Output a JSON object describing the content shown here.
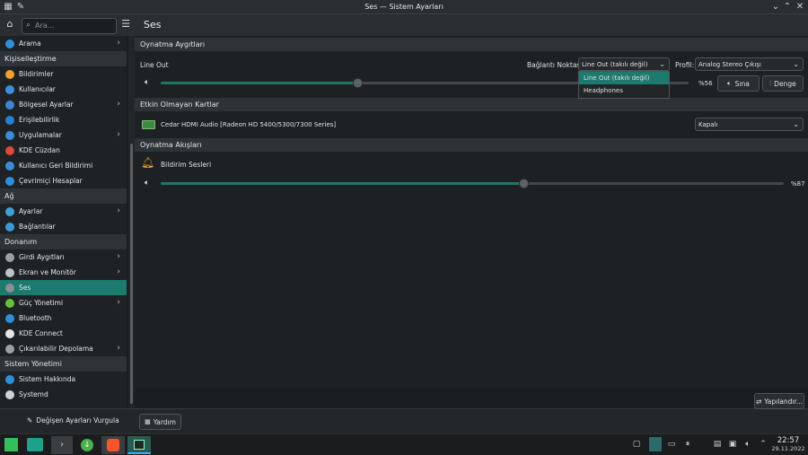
{
  "window": {
    "title": "Ses — Sistem Ayarları"
  },
  "search": {
    "placeholder": "Ara..."
  },
  "sidebar": {
    "items": [
      {
        "type": "item",
        "label": "Arama",
        "icon": "search-icon",
        "color": "#2f8fd8",
        "chev": true
      },
      {
        "type": "section",
        "label": "Kişiselleştirme"
      },
      {
        "type": "item",
        "label": "Bildirimler",
        "icon": "bell-icon",
        "color": "#f0a030"
      },
      {
        "type": "item",
        "label": "Kullanıcılar",
        "icon": "users-icon",
        "color": "#3d8fd6"
      },
      {
        "type": "item",
        "label": "Bölgesel Ayarlar",
        "icon": "flag-icon",
        "color": "#3a86d4",
        "chev": true
      },
      {
        "type": "item",
        "label": "Erişilebilirlik",
        "icon": "accessibility-icon",
        "color": "#2a7fd2"
      },
      {
        "type": "item",
        "label": "Uygulamalar",
        "icon": "apps-icon",
        "color": "#3c8ad8",
        "chev": true
      },
      {
        "type": "item",
        "label": "KDE Cüzdan",
        "icon": "wallet-icon",
        "color": "#d94a3a"
      },
      {
        "type": "item",
        "label": "Kullanıcı Geri Bildirimi",
        "icon": "feedback-icon",
        "color": "#3a8cd6"
      },
      {
        "type": "item",
        "label": "Çevrimiçi Hesaplar",
        "icon": "accounts-icon",
        "color": "#2f8fd8"
      },
      {
        "type": "section",
        "label": "Ağ"
      },
      {
        "type": "item",
        "label": "Ayarlar",
        "icon": "globe-icon",
        "color": "#3fa0d8",
        "chev": true
      },
      {
        "type": "item",
        "label": "Bağlantılar",
        "icon": "network-icon",
        "color": "#3a9ad6"
      },
      {
        "type": "section",
        "label": "Donanım"
      },
      {
        "type": "item",
        "label": "Girdi Aygıtları",
        "icon": "input-devices-icon",
        "color": "#9aa0a6",
        "chev": true
      },
      {
        "type": "item",
        "label": "Ekran ve Monitör",
        "icon": "monitor-icon",
        "color": "#bfc3c6",
        "chev": true
      },
      {
        "type": "item",
        "label": "Ses",
        "icon": "speaker-icon",
        "color": "#8a8f94",
        "active": true
      },
      {
        "type": "item",
        "label": "Güç Yönetimi",
        "icon": "power-icon",
        "color": "#6abf3a",
        "chev": true
      },
      {
        "type": "item",
        "label": "Bluetooth",
        "icon": "bluetooth-icon",
        "color": "#2f8fd8"
      },
      {
        "type": "item",
        "label": "KDE Connect",
        "icon": "kde-connect-icon",
        "color": "#e6e6e6"
      },
      {
        "type": "item",
        "label": "Çıkarılabilir Depolama",
        "icon": "usb-icon",
        "color": "#9aa0a6",
        "chev": true
      },
      {
        "type": "section",
        "label": "Sistem Yönetimi"
      },
      {
        "type": "item",
        "label": "Sistem Hakkında",
        "icon": "info-icon",
        "color": "#2f8fd8"
      },
      {
        "type": "item",
        "label": "Systemd",
        "icon": "terminal-icon",
        "color": "#cfd3d6"
      }
    ]
  },
  "page": {
    "title": "Ses"
  },
  "playback": {
    "header": "Oynatma Aygıtları",
    "device": "Line Out",
    "port_label": "Bağlantı Noktası:",
    "port_value": "Line Out (takılı değil)",
    "profile_label": "Profil:",
    "profile_value": "Analog Stereo Çıkışı",
    "volume_text": "%56",
    "volume": 0.37,
    "test_label": "Sına",
    "balance_label": "Denge",
    "dropdown_options": [
      "Line Out (takılı değil)",
      "Headphones"
    ]
  },
  "inactive": {
    "header": "Etkin Olmayan Kartlar",
    "card": "Cedar HDMI Audio [Radeon HD 5400/5300/7300 Series]",
    "profile_value": "Kapalı"
  },
  "streams": {
    "header": "Oynatma Akışları",
    "name": "Bildirim Sesleri",
    "volume_text": "%87",
    "volume": 0.58
  },
  "bottom": {
    "highlight_label": "Değişen Ayarları Vurgula",
    "help_label": "Yardım",
    "configure_label": "Yapılandır..."
  },
  "taskbar": {
    "time": "22:57",
    "date": "29.11.2022"
  },
  "colors": {
    "accent": "#1d7a6f",
    "slider_fill": "#1b7868"
  }
}
